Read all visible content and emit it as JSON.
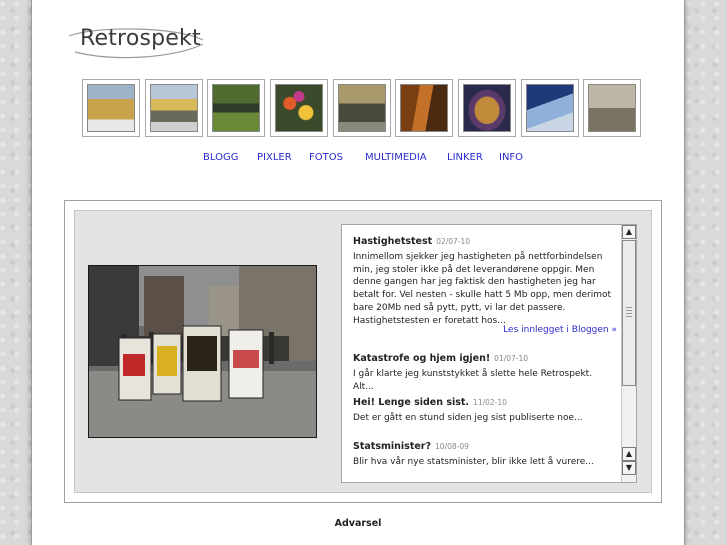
{
  "logo": {
    "text": "Retrospekt"
  },
  "thumbnails": [
    {
      "name": "thumb-yellow-building",
      "alt": "building"
    },
    {
      "name": "thumb-street-houses",
      "alt": "houses"
    },
    {
      "name": "thumb-canal",
      "alt": "canal"
    },
    {
      "name": "thumb-flowers",
      "alt": "flowers"
    },
    {
      "name": "thumb-statue",
      "alt": "statue"
    },
    {
      "name": "thumb-wood",
      "alt": "wood"
    },
    {
      "name": "thumb-mask",
      "alt": "mask"
    },
    {
      "name": "thumb-glass-building",
      "alt": "glass building"
    },
    {
      "name": "thumb-stone-sculpture",
      "alt": "sculpture"
    }
  ],
  "nav": {
    "items": [
      "BLOGG",
      "PIXLER",
      "FOTOS",
      "MULTIMEDIA",
      "LINKER",
      "INFO"
    ]
  },
  "blog": {
    "posts": [
      {
        "title": "Hastighetstest",
        "date": "02/07-10",
        "body": "Innimellom sjekker jeg hastigheten på nettforbindelsen min, jeg stoler ikke på det leverandørene oppgir. Men denne gangen har jeg faktisk den hastigheten jeg har betalt for. Vel nesten - skulle hatt 5 Mb opp, men derimot bare 20Mb ned så pytt, pytt, vi lar det passere. Hastighetstesten er foretatt hos...",
        "readmore": "Les innlegget i Bloggen »"
      },
      {
        "title": "Katastrofe og hjem igjen!",
        "date": "01/07-10",
        "body": "I går klarte jeg kunststykket å slette hele Retrospekt. Alt..."
      },
      {
        "title": "Hei! Lenge siden sist.",
        "date": "11/02-10",
        "body": "Det er gått en stund siden jeg sist publiserte noe..."
      },
      {
        "title": "Statsminister?",
        "date": "10/08-09",
        "body": "Blir hva vår nye statsminister, blir ikke lett å vurere..."
      }
    ],
    "scroll": {
      "up_icon": "arrow-up-icon",
      "down_icon": "arrow-down-icon"
    }
  },
  "footer": {
    "text": "Advarsel"
  },
  "colors": {
    "link": "#2a2ad0",
    "page_bg": "#ffffff",
    "body_bg": "#d9d9d9"
  }
}
